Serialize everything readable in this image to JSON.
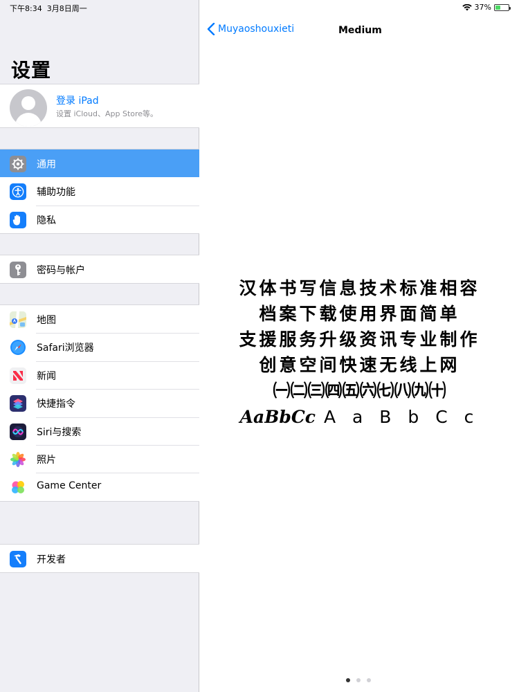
{
  "status_bar": {
    "time": "下午8:34",
    "date": "3月8日周一",
    "battery": "37%",
    "battery_level": 0.37,
    "icons": [
      "wifi-icon",
      "battery-icon"
    ]
  },
  "sidebar": {
    "title": "设置",
    "profile": {
      "name": "登录 iPad",
      "subtitle": "设置 iCloud、App Store等。"
    },
    "groups": [
      [
        {
          "label": "通用",
          "icon": "gear-icon",
          "color": "#8e8e93",
          "selected": true
        },
        {
          "label": "辅助功能",
          "icon": "accessibility-icon",
          "color": "#147efb"
        },
        {
          "label": "隐私",
          "icon": "hand-icon",
          "color": "#147efb"
        }
      ],
      [
        {
          "label": "密码与帐户",
          "icon": "key-icon",
          "color": "#8e8e93"
        }
      ],
      [
        {
          "label": "地图",
          "icon": "maps-icon",
          "color": "#6cc36f"
        },
        {
          "label": "Safari浏览器",
          "icon": "safari-icon",
          "color": "#1a8cff"
        },
        {
          "label": "新闻",
          "icon": "news-icon",
          "color": "#f0f0f2"
        },
        {
          "label": "快捷指令",
          "icon": "shortcuts-icon",
          "color": "#3b3f8f"
        },
        {
          "label": "Siri与搜索",
          "icon": "siri-icon",
          "color": "#1c1c3a"
        },
        {
          "label": "照片",
          "icon": "photos-icon",
          "color": "#ffffff"
        },
        {
          "label": "Game Center",
          "icon": "game-center-icon",
          "color": "#ffffff"
        }
      ],
      [
        {
          "label": "开发者",
          "icon": "hammer-icon",
          "color": "#147efb"
        }
      ]
    ]
  },
  "detail": {
    "back_label": "Muyaoshouxieti",
    "title": "Medium",
    "preview": {
      "lines": [
        "汉体书写信息技术标准相容",
        "档案下载使用界面简单",
        "支援服务升级资讯专业制作",
        "创意空间快速无线上网",
        "㈠㈡㈢㈣㈤㈥㈦㈧㈨㈩"
      ],
      "latin_italic": "AaBbCc",
      "latin_plain": "AaBbCc"
    },
    "page_dots": 3,
    "page_index": 0
  },
  "colors": {
    "accent": "#007aff",
    "selected_row": "#4a9ff6",
    "sidebar_bg": "#efeff4"
  }
}
